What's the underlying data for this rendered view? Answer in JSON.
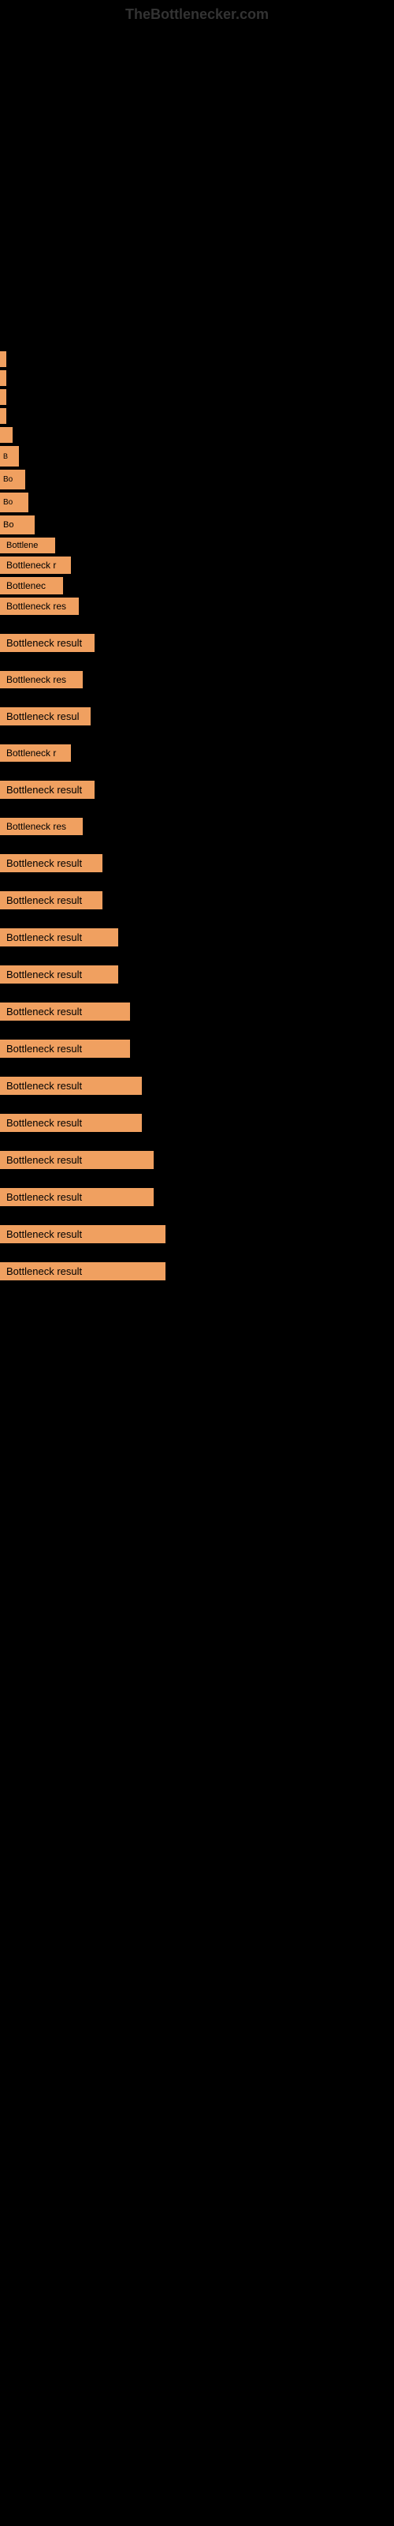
{
  "site": {
    "title": "TheBottlenecker.com"
  },
  "items": [
    {
      "id": 0,
      "label": ""
    },
    {
      "id": 1,
      "label": ""
    },
    {
      "id": 2,
      "label": ""
    },
    {
      "id": 3,
      "label": ""
    },
    {
      "id": 4,
      "label": ""
    },
    {
      "id": 5,
      "label": "B"
    },
    {
      "id": 6,
      "label": "Bo"
    },
    {
      "id": 7,
      "label": "Bo"
    },
    {
      "id": 8,
      "label": "Bo"
    },
    {
      "id": 9,
      "label": "Bottlene"
    },
    {
      "id": 10,
      "label": "Bottleneck r"
    },
    {
      "id": 11,
      "label": "Bottlenec"
    },
    {
      "id": 12,
      "label": "Bottleneck res"
    },
    {
      "id": 13,
      "label": "Bottleneck result"
    },
    {
      "id": 14,
      "label": "Bottleneck res"
    },
    {
      "id": 15,
      "label": "Bottleneck resul"
    },
    {
      "id": 16,
      "label": "Bottleneck r"
    },
    {
      "id": 17,
      "label": "Bottleneck result"
    },
    {
      "id": 18,
      "label": "Bottleneck res"
    },
    {
      "id": 19,
      "label": "Bottleneck result"
    },
    {
      "id": 20,
      "label": "Bottleneck result"
    },
    {
      "id": 21,
      "label": "Bottleneck result"
    },
    {
      "id": 22,
      "label": "Bottleneck result"
    },
    {
      "id": 23,
      "label": "Bottleneck result"
    },
    {
      "id": 24,
      "label": "Bottleneck result"
    },
    {
      "id": 25,
      "label": "Bottleneck result"
    },
    {
      "id": 26,
      "label": "Bottleneck result"
    },
    {
      "id": 27,
      "label": "Bottleneck result"
    },
    {
      "id": 28,
      "label": "Bottleneck result"
    },
    {
      "id": 29,
      "label": "Bottleneck result"
    },
    {
      "id": 30,
      "label": "Bottleneck result"
    }
  ]
}
